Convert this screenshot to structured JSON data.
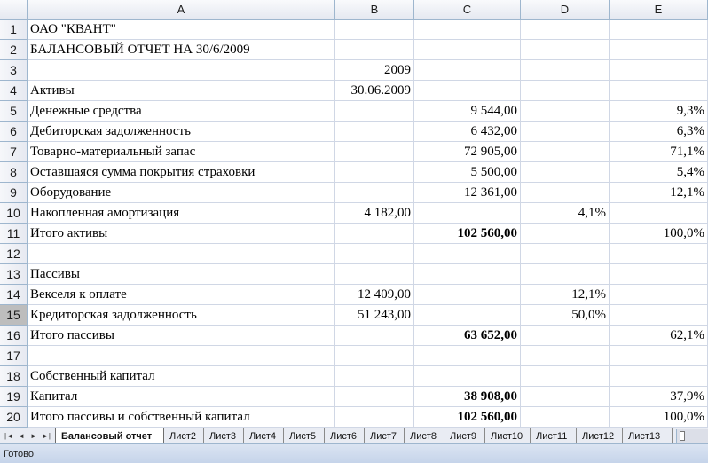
{
  "columns": [
    "A",
    "B",
    "C",
    "D",
    "E"
  ],
  "rows": [
    {
      "n": "1",
      "a": "ОАО \"КВАНТ\"",
      "b": "",
      "c": "",
      "d": "",
      "e": ""
    },
    {
      "n": "2",
      "a": "БАЛАНСОВЫЙ ОТЧЕТ НА 30/6/2009",
      "b": "",
      "c": "",
      "d": "",
      "e": ""
    },
    {
      "n": "3",
      "a": "",
      "b": "2009",
      "c": "",
      "d": "",
      "e": ""
    },
    {
      "n": "4",
      "a": "Активы",
      "b": "30.06.2009",
      "c": "",
      "d": "",
      "e": ""
    },
    {
      "n": "5",
      "a": "Денежные средства",
      "b": "",
      "c": "9 544,00",
      "d": "",
      "e": "9,3%"
    },
    {
      "n": "6",
      "a": "Дебиторская задолженность",
      "b": "",
      "c": "6 432,00",
      "d": "",
      "e": "6,3%"
    },
    {
      "n": "7",
      "a": "Товарно-материальный запас",
      "b": "",
      "c": "72 905,00",
      "d": "",
      "e": "71,1%"
    },
    {
      "n": "8",
      "a": "Оставшаяся сумма покрытия страховки",
      "b": "",
      "c": "5 500,00",
      "d": "",
      "e": "5,4%"
    },
    {
      "n": "9",
      "a": "Оборудование",
      "b": "",
      "c": "12 361,00",
      "d": "",
      "e": "12,1%"
    },
    {
      "n": "10",
      "a": "Накопленная амортизация",
      "b": "4 182,00",
      "c": "",
      "d": "4,1%",
      "e": ""
    },
    {
      "n": "11",
      "a": "Итого активы",
      "b": "",
      "c": "102 560,00",
      "d": "",
      "e": "100,0%",
      "bold_c": true
    },
    {
      "n": "12",
      "a": "",
      "b": "",
      "c": "",
      "d": "",
      "e": ""
    },
    {
      "n": "13",
      "a": "Пассивы",
      "b": "",
      "c": "",
      "d": "",
      "e": ""
    },
    {
      "n": "14",
      "a": "Векселя к оплате",
      "b": "12 409,00",
      "c": "",
      "d": "12,1%",
      "e": ""
    },
    {
      "n": "15",
      "a": "Кредиторская задолженность",
      "b": "51 243,00",
      "c": "",
      "d": "50,0%",
      "e": "",
      "active": true
    },
    {
      "n": "16",
      "a": "Итого пассивы",
      "b": "",
      "c": "63 652,00",
      "d": "",
      "e": "62,1%",
      "bold_c": true
    },
    {
      "n": "17",
      "a": "",
      "b": "",
      "c": "",
      "d": "",
      "e": ""
    },
    {
      "n": "18",
      "a": "Собственный капитал",
      "b": "",
      "c": "",
      "d": "",
      "e": ""
    },
    {
      "n": "19",
      "a": "Капитал",
      "b": "",
      "c": "38 908,00",
      "d": "",
      "e": "37,9%",
      "bold_c": true
    },
    {
      "n": "20",
      "a": "Итого пассивы и собственный капитал",
      "b": "",
      "c": "102 560,00",
      "d": "",
      "e": "100,0%",
      "bold_c": true
    }
  ],
  "sheet_tabs": [
    "Балансовый отчет",
    "Лист2",
    "Лист3",
    "Лист4",
    "Лист5",
    "Лист6",
    "Лист7",
    "Лист8",
    "Лист9",
    "Лист10",
    "Лист11",
    "Лист12",
    "Лист13"
  ],
  "active_tab_index": 0,
  "nav_buttons": [
    {
      "name": "first-sheet-button",
      "glyph": "|◄"
    },
    {
      "name": "prev-sheet-button",
      "glyph": "◄"
    },
    {
      "name": "next-sheet-button",
      "glyph": "►"
    },
    {
      "name": "last-sheet-button",
      "glyph": "►|"
    }
  ],
  "status": "Готово",
  "colors": {
    "grid": "#d0d7e5",
    "header_border": "#9eb6ce",
    "active_row_header": "#bdbdbd"
  }
}
